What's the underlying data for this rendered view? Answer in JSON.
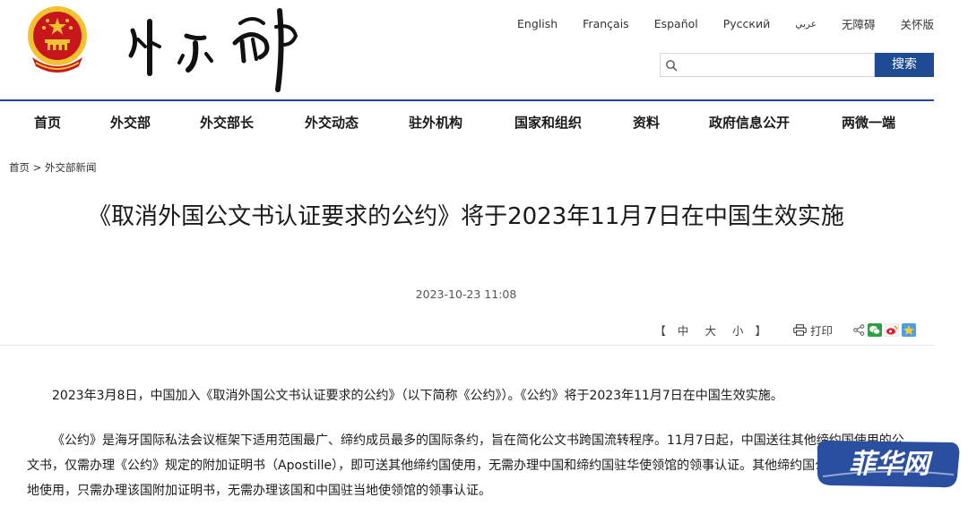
{
  "header": {
    "brand_alt": "外交部",
    "languages": [
      "English",
      "Français",
      "Español",
      "Русский",
      "عربي",
      "无障碍",
      "关怀版"
    ],
    "search": {
      "placeholder": "",
      "value": "",
      "button_label": "搜索"
    }
  },
  "nav": {
    "items": [
      "首页",
      "外交部",
      "外交部长",
      "外交动态",
      "驻外机构",
      "国家和组织",
      "资料",
      "政府信息公开",
      "两微一端"
    ]
  },
  "breadcrumb": {
    "home": "首页",
    "separator": ">",
    "current": "外交部新闻"
  },
  "article": {
    "title": "《取消外国公文书认证要求的公约》将于2023年11月7日在中国生效实施",
    "date": "2023-10-23 11:08",
    "font_size": {
      "open": "【",
      "large": "中",
      "medium": "大",
      "small": "小",
      "close": "】"
    },
    "print_label": "打印",
    "paragraphs": [
      "2023年3月8日，中国加入《取消外国公文书认证要求的公约》（以下简称《公约》）。《公约》将于2023年11月7日在中国生效实施。",
      "《公约》是海牙国际私法会议框架下适用范围最广、缔约成员最多的国际条约，旨在简化公文书跨国流转程序。11月7日起，中国送往其他缔约国使用的公文书，仅需办理《公约》规定的附加证明书（Apostille），即可送其他缔约国使用，无需办理中国和缔约国驻华使领馆的领事认证。其他缔约国公文书送中国内地使用，只需办理该国附加证明书，无需办理该国和中国驻当地使领馆的领事认证。"
    ]
  },
  "watermark": {
    "text": "菲华网"
  },
  "colors": {
    "accent": "#1d4c93",
    "emblem_red": "#c8161d",
    "emblem_gold": "#f2c230",
    "watermark": "#2a4fa0"
  }
}
